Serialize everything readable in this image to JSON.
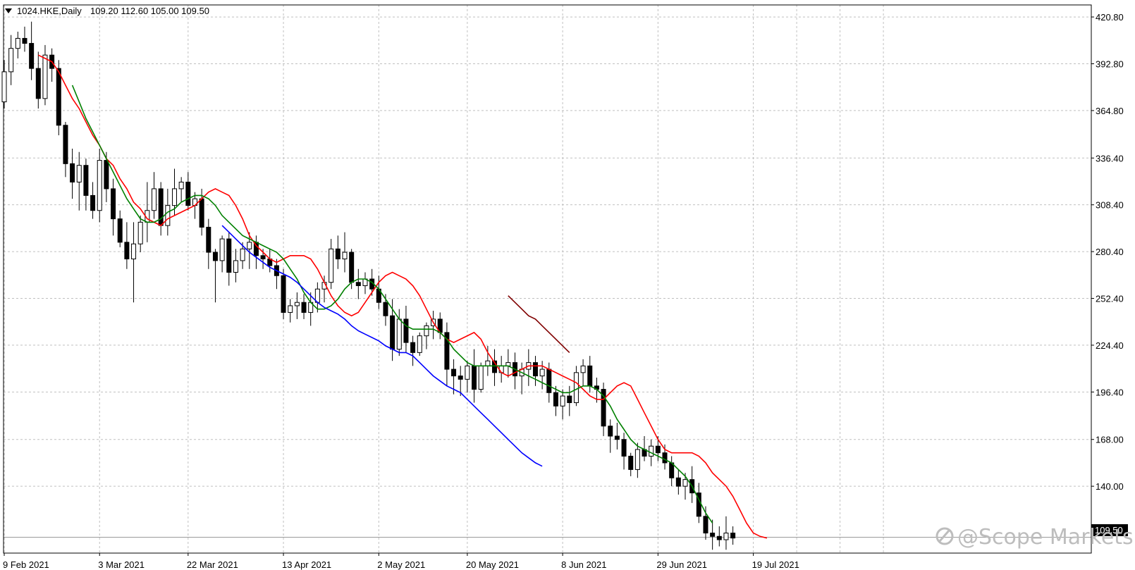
{
  "header": {
    "symbol": "1024.HKE,Daily",
    "ohlc": "109.20 112.60 105.00 109.50",
    "menu_icon": "triangle-down-icon"
  },
  "watermark": {
    "text": "@Scope Markets",
    "icon": "scope-logo-icon"
  },
  "colors": {
    "background": "#ffffff",
    "grid": "#c0c0c0",
    "candle": "#000000",
    "ma_red": "#ff0000",
    "ma_green": "#008000",
    "ma_blue": "#0000ff",
    "ma_maroon": "#800000",
    "last_price_bg": "#000000"
  },
  "chart_data": {
    "type": "candlestick",
    "ylim": [
      100,
      428
    ],
    "y_ticks": [
      "420.80",
      "392.80",
      "364.80",
      "336.40",
      "308.40",
      "280.40",
      "252.40",
      "224.40",
      "196.40",
      "168.00",
      "140.00"
    ],
    "last_price_label": "109.50",
    "x_ticks": [
      {
        "label": "9 Feb 2021",
        "index": 0
      },
      {
        "label": "3 Mar 2021",
        "index": 14
      },
      {
        "label": "22 Mar 2021",
        "index": 27
      },
      {
        "label": "13 Apr 2021",
        "index": 41
      },
      {
        "label": "2 May 2021",
        "index": 55
      },
      {
        "label": "20 May 2021",
        "index": 68
      },
      {
        "label": "8 Jun 2021",
        "index": 82
      },
      {
        "label": "29 Jun 2021",
        "index": 96
      },
      {
        "label": "19 Jul 2021",
        "index": 110
      }
    ],
    "grid": true,
    "candles": [
      [
        370,
        395,
        366,
        388
      ],
      [
        388,
        410,
        380,
        402
      ],
      [
        402,
        412,
        396,
        408
      ],
      [
        408,
        415,
        400,
        405
      ],
      [
        405,
        418,
        383,
        390
      ],
      [
        390,
        400,
        366,
        372
      ],
      [
        372,
        404,
        368,
        398
      ],
      [
        398,
        402,
        382,
        390
      ],
      [
        390,
        395,
        350,
        356
      ],
      [
        356,
        358,
        325,
        333
      ],
      [
        333,
        342,
        312,
        322
      ],
      [
        322,
        340,
        305,
        332
      ],
      [
        332,
        336,
        305,
        314
      ],
      [
        314,
        322,
        300,
        305
      ],
      [
        305,
        342,
        298,
        335
      ],
      [
        335,
        340,
        310,
        318
      ],
      [
        318,
        324,
        290,
        300
      ],
      [
        300,
        305,
        283,
        286
      ],
      [
        286,
        298,
        270,
        276
      ],
      [
        276,
        298,
        250,
        285
      ],
      [
        285,
        302,
        280,
        298
      ],
      [
        298,
        322,
        286,
        305
      ],
      [
        305,
        328,
        300,
        318
      ],
      [
        318,
        322,
        290,
        296
      ],
      [
        296,
        318,
        290,
        308
      ],
      [
        308,
        330,
        302,
        318
      ],
      [
        318,
        325,
        310,
        322
      ],
      [
        322,
        328,
        305,
        308
      ],
      [
        308,
        316,
        300,
        312
      ],
      [
        312,
        318,
        290,
        295
      ],
      [
        295,
        300,
        270,
        280
      ],
      [
        280,
        282,
        250,
        275
      ],
      [
        275,
        290,
        268,
        288
      ],
      [
        288,
        292,
        260,
        268
      ],
      [
        268,
        282,
        262,
        275
      ],
      [
        275,
        286,
        270,
        282
      ],
      [
        282,
        292,
        270,
        286
      ],
      [
        286,
        290,
        270,
        278
      ],
      [
        278,
        282,
        270,
        276
      ],
      [
        276,
        282,
        268,
        272
      ],
      [
        272,
        276,
        258,
        266
      ],
      [
        266,
        270,
        240,
        244
      ],
      [
        244,
        252,
        238,
        248
      ],
      [
        248,
        256,
        240,
        250
      ],
      [
        250,
        255,
        240,
        244
      ],
      [
        244,
        256,
        236,
        250
      ],
      [
        250,
        262,
        244,
        258
      ],
      [
        258,
        266,
        250,
        262
      ],
      [
        262,
        288,
        258,
        282
      ],
      [
        282,
        290,
        270,
        276
      ],
      [
        276,
        292,
        268,
        280
      ],
      [
        280,
        282,
        258,
        262
      ],
      [
        262,
        270,
        252,
        260
      ],
      [
        260,
        268,
        255,
        264
      ],
      [
        264,
        270,
        254,
        258
      ],
      [
        258,
        266,
        246,
        250
      ],
      [
        250,
        255,
        236,
        242
      ],
      [
        242,
        252,
        215,
        222
      ],
      [
        222,
        246,
        218,
        240
      ],
      [
        240,
        248,
        220,
        226
      ],
      [
        226,
        230,
        212,
        220
      ],
      [
        220,
        232,
        218,
        230
      ],
      [
        230,
        238,
        222,
        236
      ],
      [
        236,
        245,
        228,
        240
      ],
      [
        240,
        244,
        228,
        232
      ],
      [
        232,
        238,
        200,
        210
      ],
      [
        210,
        216,
        195,
        206
      ],
      [
        206,
        212,
        194,
        204
      ],
      [
        204,
        215,
        196,
        212
      ],
      [
        212,
        222,
        190,
        198
      ],
      [
        198,
        214,
        196,
        212
      ],
      [
        212,
        224,
        206,
        215
      ],
      [
        215,
        222,
        200,
        208
      ],
      [
        208,
        218,
        202,
        212
      ],
      [
        212,
        222,
        205,
        214
      ],
      [
        214,
        220,
        198,
        206
      ],
      [
        206,
        214,
        195,
        210
      ],
      [
        210,
        222,
        200,
        214
      ],
      [
        214,
        218,
        200,
        206
      ],
      [
        206,
        215,
        198,
        210
      ],
      [
        210,
        214,
        190,
        196
      ],
      [
        196,
        200,
        182,
        188
      ],
      [
        188,
        198,
        180,
        194
      ],
      [
        194,
        200,
        182,
        190
      ],
      [
        190,
        212,
        188,
        208
      ],
      [
        208,
        216,
        200,
        212
      ],
      [
        212,
        218,
        196,
        200
      ],
      [
        200,
        205,
        190,
        198
      ],
      [
        198,
        202,
        170,
        176
      ],
      [
        176,
        180,
        160,
        170
      ],
      [
        170,
        178,
        162,
        168
      ],
      [
        168,
        172,
        150,
        158
      ],
      [
        158,
        160,
        146,
        150
      ],
      [
        150,
        166,
        145,
        162
      ],
      [
        162,
        170,
        155,
        158
      ],
      [
        158,
        168,
        152,
        164
      ],
      [
        164,
        170,
        155,
        160
      ],
      [
        160,
        165,
        150,
        154
      ],
      [
        154,
        158,
        140,
        145
      ],
      [
        145,
        150,
        135,
        140
      ],
      [
        140,
        148,
        132,
        144
      ],
      [
        144,
        152,
        130,
        136
      ],
      [
        136,
        142,
        118,
        122
      ],
      [
        122,
        128,
        108,
        112
      ],
      [
        112,
        120,
        102,
        110
      ],
      [
        110,
        116,
        104,
        108
      ],
      [
        108,
        122,
        102,
        112
      ],
      [
        112,
        116,
        105,
        109
      ]
    ],
    "series": [
      {
        "color_key": "ma_red",
        "start": 5,
        "values": [
          398,
          396,
          394,
          388,
          380,
          372,
          366,
          358,
          350,
          344,
          336,
          332,
          324,
          318,
          310,
          306,
          300,
          298,
          296,
          300,
          302,
          304,
          306,
          308,
          312,
          316,
          318,
          316,
          314,
          308,
          300,
          290,
          284,
          280,
          276,
          274,
          276,
          278,
          278,
          278,
          276,
          270,
          262,
          254,
          248,
          244,
          242,
          244,
          250,
          256,
          262,
          266,
          268,
          266,
          264,
          260,
          254,
          246,
          238,
          232,
          228,
          226,
          228,
          230,
          232,
          228,
          220,
          214,
          208,
          206,
          208,
          210,
          212,
          212,
          212,
          210,
          208,
          206,
          204,
          202,
          198,
          194,
          192,
          192,
          196,
          200,
          202,
          200,
          192,
          184,
          176,
          168,
          162,
          160,
          160,
          160,
          160,
          158,
          154,
          148,
          144,
          140,
          134,
          126,
          118,
          112,
          110,
          109
        ]
      },
      {
        "color_key": "ma_green",
        "start": 10,
        "values": [
          380,
          370,
          360,
          352,
          344,
          336,
          328,
          320,
          312,
          306,
          300,
          298,
          298,
          300,
          304,
          306,
          310,
          312,
          314,
          314,
          312,
          308,
          302,
          298,
          294,
          290,
          288,
          286,
          284,
          282,
          280,
          276,
          270,
          264,
          256,
          250,
          246,
          246,
          248,
          252,
          258,
          262,
          264,
          264,
          262,
          258,
          252,
          246,
          240,
          236,
          234,
          234,
          234,
          234,
          232,
          228,
          222,
          218,
          214,
          212,
          212,
          212,
          212,
          212,
          212,
          210,
          208,
          206,
          204,
          202,
          200,
          198,
          196,
          196,
          198,
          200,
          200,
          198,
          194,
          188,
          180,
          174,
          168,
          164,
          162,
          160,
          158,
          156,
          154,
          150,
          146,
          140,
          132,
          124,
          118
        ]
      },
      {
        "color_key": "ma_blue",
        "start": 32,
        "values": [
          296,
          292,
          288,
          284,
          280,
          277,
          274,
          271,
          269,
          267,
          265,
          262,
          258,
          254,
          250,
          247,
          245,
          243,
          240,
          236,
          233,
          231,
          229,
          227,
          224,
          222,
          220,
          220,
          218,
          214,
          210,
          206,
          203,
          200,
          198,
          196,
          192,
          188,
          184,
          180,
          176,
          172,
          168,
          164,
          160,
          157,
          154,
          152
        ]
      },
      {
        "color_key": "ma_maroon",
        "start": 74,
        "values": [
          254,
          250,
          246,
          242,
          240,
          236,
          232,
          228,
          224,
          220
        ]
      }
    ]
  }
}
